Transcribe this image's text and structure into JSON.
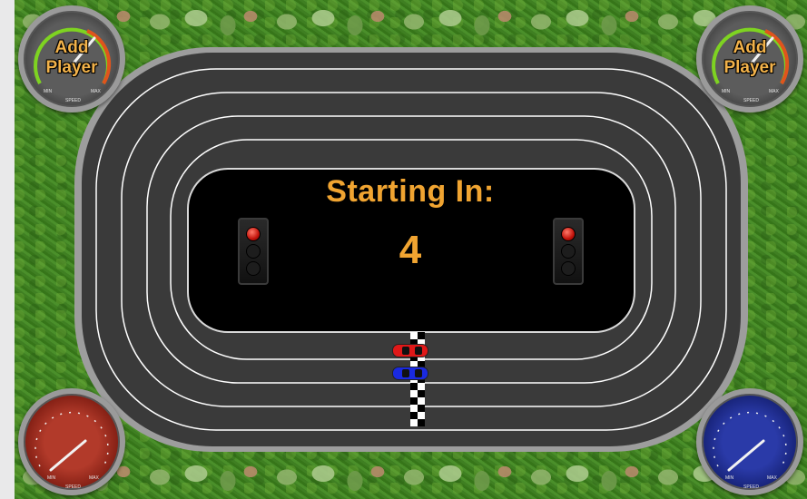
{
  "countdown": {
    "label": "Starting In:",
    "value": "4"
  },
  "players": {
    "top_left": {
      "label_line1": "Add",
      "label_line2": "Player",
      "gauge_min": "MIN",
      "gauge_max": "MAX",
      "gauge_speed": "SPEED"
    },
    "top_right": {
      "label_line1": "Add",
      "label_line2": "Player",
      "gauge_min": "MIN",
      "gauge_max": "MAX",
      "gauge_speed": "SPEED"
    },
    "bottom_left": {
      "color": "#b23a2a",
      "gauge_min": "MIN",
      "gauge_max": "MAX",
      "gauge_speed": "SPEED"
    },
    "bottom_right": {
      "color": "#2a3aa8",
      "gauge_min": "MIN",
      "gauge_max": "MAX",
      "gauge_speed": "SPEED"
    }
  },
  "cars": [
    {
      "color": "#e01818"
    },
    {
      "color": "#1a2ae0"
    }
  ],
  "colors": {
    "accent_text": "#f0a431",
    "track": "#3a3a3a",
    "lane_line": "#ffffff",
    "grass": "#3e7d21"
  }
}
